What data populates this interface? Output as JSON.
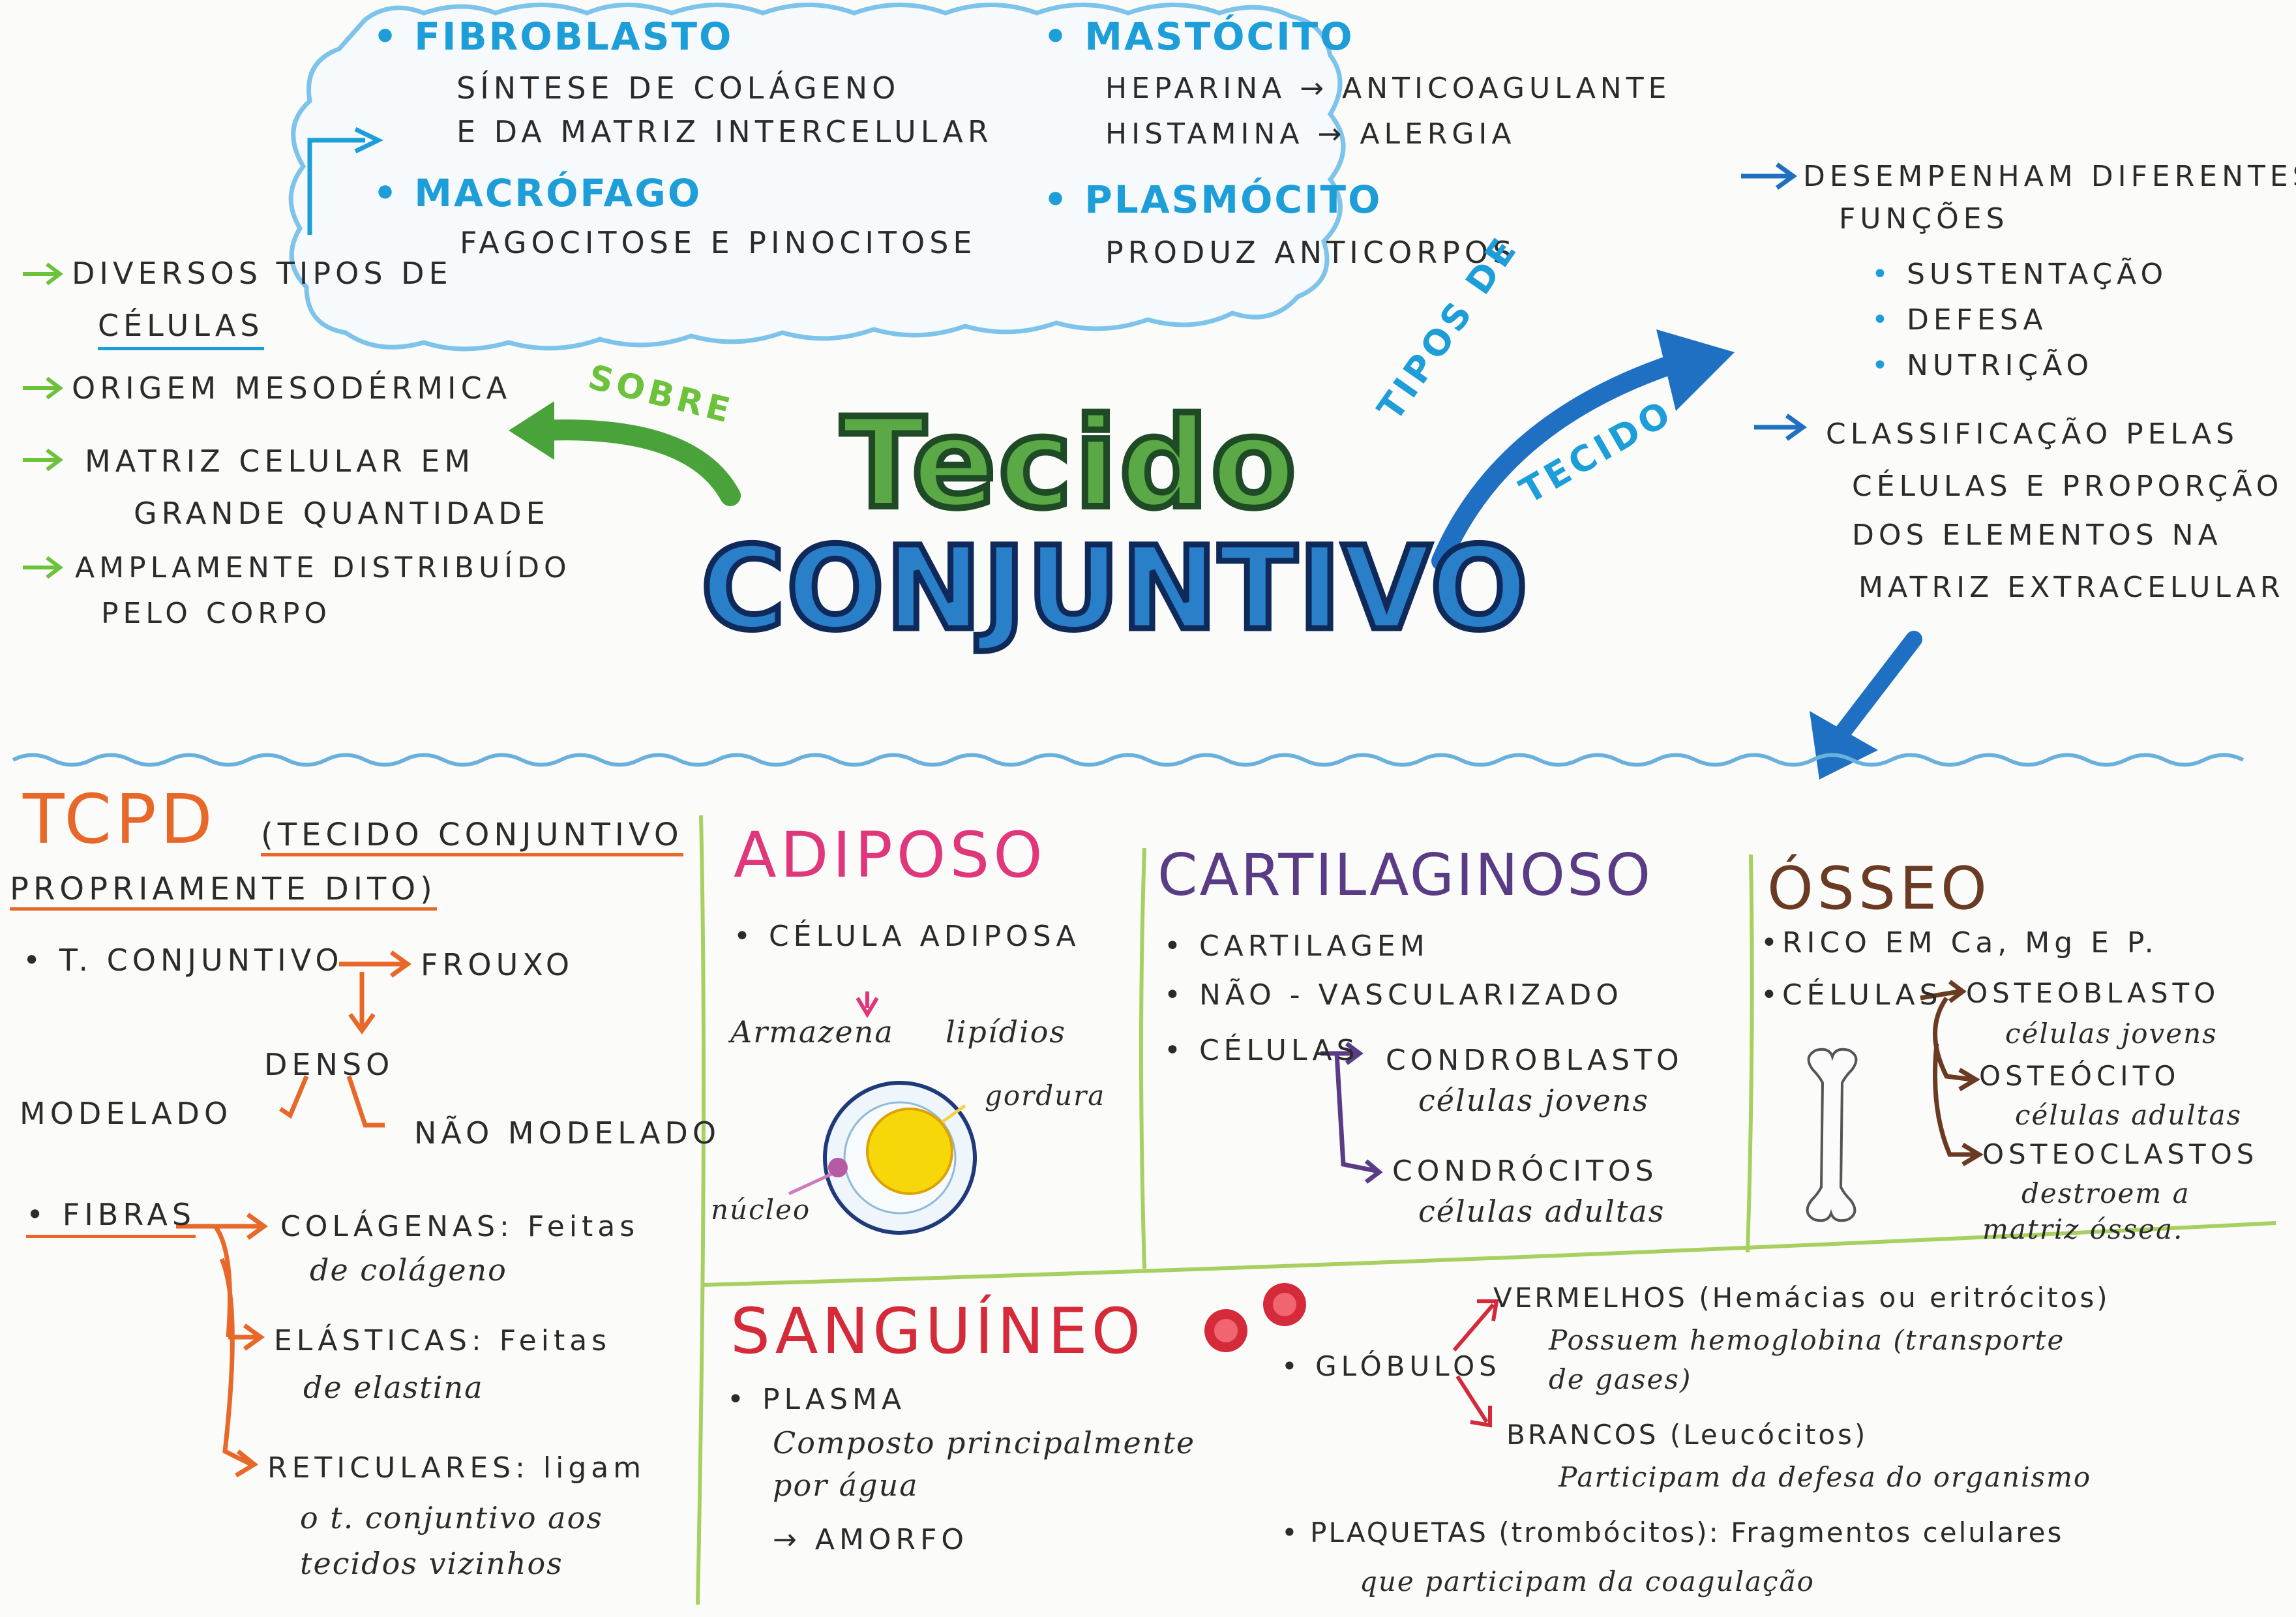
{
  "title": {
    "line1": "Tecido",
    "line2": "CONJUNTIVO"
  },
  "cells": [
    {
      "name": "FIBROBLASTO",
      "lines": [
        "SÍNTESE DE COLÁGENO",
        "E DA MATRIZ INTERCELULAR"
      ]
    },
    {
      "name": "MASTÓCITO",
      "lines": [
        "HEPARINA → ANTICOAGULANTE",
        "HISTAMINA → ALERGIA"
      ]
    },
    {
      "name": "MACRÓFAGO",
      "lines": [
        "FAGOCITOSE E PINOCITOSE"
      ]
    },
    {
      "name": "PLASMÓCITO",
      "lines": [
        "PRODUZ ANTICORPOS"
      ]
    }
  ],
  "sobre": {
    "label": "SOBRE",
    "items": [
      {
        "text": "DIVERSOS TIPOS DE",
        "text2": "CÉLULAS"
      },
      {
        "text": "ORIGEM MESODÉRMICA"
      },
      {
        "text": "MATRIZ CELULAR EM",
        "text2": "GRANDE QUANTIDADE"
      },
      {
        "text": "AMPLAMENTE DISTRIBUÍDO",
        "text2": "PELO CORPO"
      }
    ]
  },
  "tipos": {
    "label1": "TIPOS DE",
    "label2": "TECIDO",
    "functions_line1": "DESEMPENHAM DIFERENTES",
    "functions_line2": "FUNÇÕES",
    "functions": [
      "SUSTENTAÇÃO",
      "DEFESA",
      "NUTRIÇÃO"
    ],
    "class_lines": [
      "CLASSIFICAÇÃO PELAS",
      "CÉLULAS E PROPORÇÃO",
      "DOS ELEMENTOS NA",
      "MATRIZ EXTRACELULAR"
    ]
  },
  "tcpd": {
    "abbr": "TCPD",
    "full1": "(TECIDO CONJUNTIVO",
    "full2": "PROPRIAMENTE DITO)",
    "t_conj": "• T. CONJUNTIVO",
    "frouxo": "FROUXO",
    "denso": "DENSO",
    "modelado": "MODELADO",
    "nao_modelado": "NÃO MODELADO",
    "fibras": "• FIBRAS",
    "colagenas1": "COLÁGENAS: Feitas",
    "colagenas2": "de colágeno",
    "elasticas1": "ELÁSTICAS: Feitas",
    "elasticas2": "de elastina",
    "reticulares1": "RETICULARES: ligam",
    "reticulares2": "o t. conjuntivo aos",
    "reticulares3": "tecidos vizinhos"
  },
  "adiposo": {
    "title": "ADIPOSO",
    "celula": "• CÉLULA ADIPOSA",
    "armazena": "Armazena",
    "lipidios": "lipídios",
    "gordura": "gordura",
    "nucleo": "núcleo"
  },
  "cartilaginoso": {
    "title": "CARTILAGINOSO",
    "items": [
      "• CARTILAGEM",
      "• NÃO - VASCULARIZADO",
      "• CÉLULAS"
    ],
    "condroblasto": "CONDROBLASTO",
    "condroblasto_desc": "células jovens",
    "condrocitos": "CONDRÓCITOS",
    "condrocitos_desc": "células adultas"
  },
  "osseo": {
    "title": "ÓSSEO",
    "rico": "•RICO EM Ca, Mg E P.",
    "celulas": "•CÉLULAS",
    "osteoblasto": "OSTEOBLASTO",
    "osteoblasto_desc": "células jovens",
    "osteocito": "OSTEÓCITO",
    "osteocito_desc": "células adultas",
    "osteoclastos": "OSTEOCLASTOS",
    "osteoclastos_desc1": "destroem a",
    "osteoclastos_desc2": "matriz óssea."
  },
  "sanguineo": {
    "title": "SANGUÍNEO",
    "plasma": "• PLASMA",
    "plasma_desc1": "Composto principalmente",
    "plasma_desc2": "por água",
    "amorfo": "→ AMORFO",
    "globulos": "• GLÓBULOS",
    "vermelhos": "VERMELHOS (Hemácias ou eritrócitos)",
    "vermelhos_desc1": "Possuem hemoglobina (transporte",
    "vermelhos_desc2": "de gases)",
    "brancos": "BRANCOS (Leucócitos)",
    "brancos_desc": "Participam da defesa do organismo",
    "plaquetas": "• PLAQUETAS (trombócitos): Fragmentos celulares",
    "plaquetas_desc": "que participam da coagulação"
  },
  "colors": {
    "cell_blue": "#1d9ed8",
    "green": "#6cc23a",
    "dark_blue": "#1f5fae",
    "tcpd_orange": "#e8682a",
    "adiposo_pink": "#e0367a",
    "cartilaginoso_purple": "#5a3c86",
    "osseo_brown": "#6b3a22",
    "sanguineo_red": "#d42a3a",
    "divider_green": "#a8d060"
  }
}
